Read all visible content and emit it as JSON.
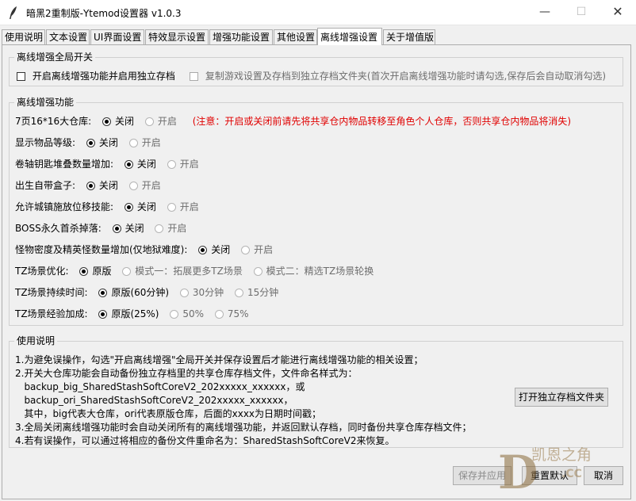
{
  "window": {
    "title": "暗黑2重制版-Ytemod设置器 v1.0.3",
    "minimize_label": "—",
    "maximize_label": "☐",
    "close_label": "✕"
  },
  "tabs": [
    {
      "label": "使用说明"
    },
    {
      "label": "文本设置"
    },
    {
      "label": "UI界面设置"
    },
    {
      "label": "特效显示设置"
    },
    {
      "label": "增强功能设置"
    },
    {
      "label": "其他设置"
    },
    {
      "label": "离线增强设置"
    },
    {
      "label": "关于增值版"
    }
  ],
  "active_tab": "离线增强设置",
  "global_switch": {
    "legend": "离线增强全局开关",
    "enable_label": "开启离线增强功能并启用独立存档",
    "copy_label": "复制游戏设置及存档到独立存档文件夹(首次开启离线增强功能时请勾选,保存后会自动取消勾选)"
  },
  "features": {
    "legend": "离线增强功能",
    "rows": [
      {
        "label": "7页16*16大仓库:",
        "options": [
          "关闭",
          "开启"
        ],
        "selected": 0,
        "warning": "(注意：开启或关闭前请先将共享仓内物品转移至角色个人仓库，否则共享仓内物品将消失)"
      },
      {
        "label": "显示物品等级:",
        "options": [
          "关闭",
          "开启"
        ],
        "selected": 0
      },
      {
        "label": "卷轴钥匙堆叠数量增加:",
        "options": [
          "关闭",
          "开启"
        ],
        "selected": 0
      },
      {
        "label": "出生自带盒子:",
        "options": [
          "关闭",
          "开启"
        ],
        "selected": 0
      },
      {
        "label": "允许城镇施放位移技能:",
        "options": [
          "关闭",
          "开启"
        ],
        "selected": 0
      },
      {
        "label": "BOSS永久首杀掉落:",
        "options": [
          "关闭",
          "开启"
        ],
        "selected": 0
      },
      {
        "label": "怪物密度及精英怪数量增加(仅地狱难度):",
        "options": [
          "关闭",
          "开启"
        ],
        "selected": 0
      },
      {
        "label": "TZ场景优化:",
        "options": [
          "原版",
          "模式一：拓展更多TZ场景",
          "模式二：精选TZ场景轮换"
        ],
        "selected": 0
      },
      {
        "label": "TZ场景持续时间:",
        "options": [
          "原版(60分钟)",
          "30分钟",
          "15分钟"
        ],
        "selected": 0
      },
      {
        "label": "TZ场景经验加成:",
        "options": [
          "原版(25%)",
          "50%",
          "75%"
        ],
        "selected": 0
      }
    ]
  },
  "help": {
    "legend": "使用说明",
    "lines": [
      "1.为避免误操作，勾选\"开启离线增强\"全局开关并保存设置后才能进行离线增强功能的相关设置；",
      "2.开关大仓库功能会自动备份独立存档里的共享仓库存档文件，文件命名样式为：",
      "   backup_big_SharedStashSoftCoreV2_202xxxxx_xxxxxx，或",
      "   backup_ori_SharedStashSoftCoreV2_202xxxxx_xxxxxx，",
      "   其中，big代表大仓库，ori代表原版仓库，后面的xxxx为日期时间戳；",
      "3.全局关闭离线增强功能时会自动关闭所有的离线增强功能，并返回默认存档，同时备份共享仓库存档文件；",
      "4.若有误操作，可以通过将相应的备份文件重命名为：SharedStashSoftCoreV2来恢复。"
    ],
    "open_folder_label": "打开独立存档文件夹"
  },
  "footer": {
    "save_label": "保存并应用",
    "reset_label": "重置默认",
    "cancel_label": "取消"
  },
  "watermark": {
    "text": "凯恩之角",
    "subtext": ".CC"
  }
}
